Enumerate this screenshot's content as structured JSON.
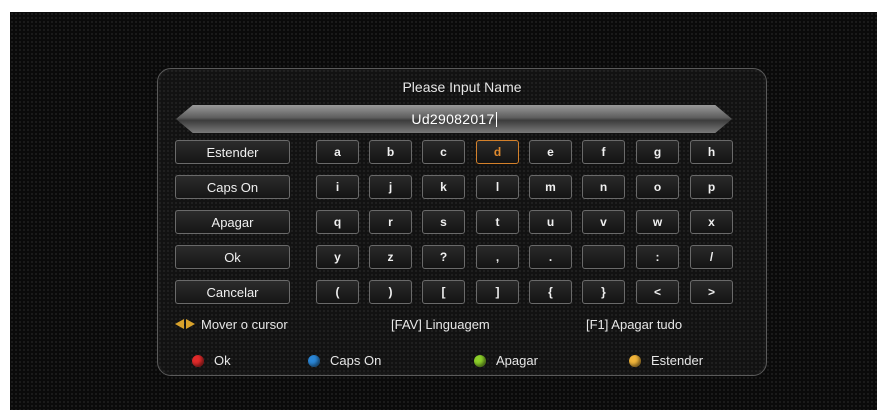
{
  "dialog": {
    "title": "Please Input Name",
    "input_value": "Ud29082017"
  },
  "side_buttons": [
    "Estender",
    "Caps On",
    "Apagar",
    "Ok",
    "Cancelar"
  ],
  "keyboard": {
    "rows": [
      [
        "a",
        "b",
        "c",
        "d",
        "e",
        "f",
        "g",
        "h"
      ],
      [
        "i",
        "j",
        "k",
        "l",
        "m",
        "n",
        "o",
        "p"
      ],
      [
        "q",
        "r",
        "s",
        "t",
        "u",
        "v",
        "w",
        "x"
      ],
      [
        "y",
        "z",
        "?",
        ",",
        ".",
        "",
        ":",
        "/"
      ],
      [
        "(",
        ")",
        "[",
        "]",
        "{",
        "}",
        "<",
        ">"
      ]
    ],
    "selected_key": "d"
  },
  "hints": {
    "cursor": "Mover o cursor",
    "language": "[FAV] Linguagem",
    "clear_all": "[F1] Apagar tudo"
  },
  "color_buttons": [
    {
      "label": "Ok",
      "color": "#e02a2a",
      "icon": "red-button-icon"
    },
    {
      "label": "Caps On",
      "color": "#2a86d6",
      "icon": "blue-button-icon"
    },
    {
      "label": "Apagar",
      "color": "#8ccf2a",
      "icon": "green-button-icon"
    },
    {
      "label": "Estender",
      "color": "#f0b43a",
      "icon": "yellow-button-icon"
    }
  ]
}
